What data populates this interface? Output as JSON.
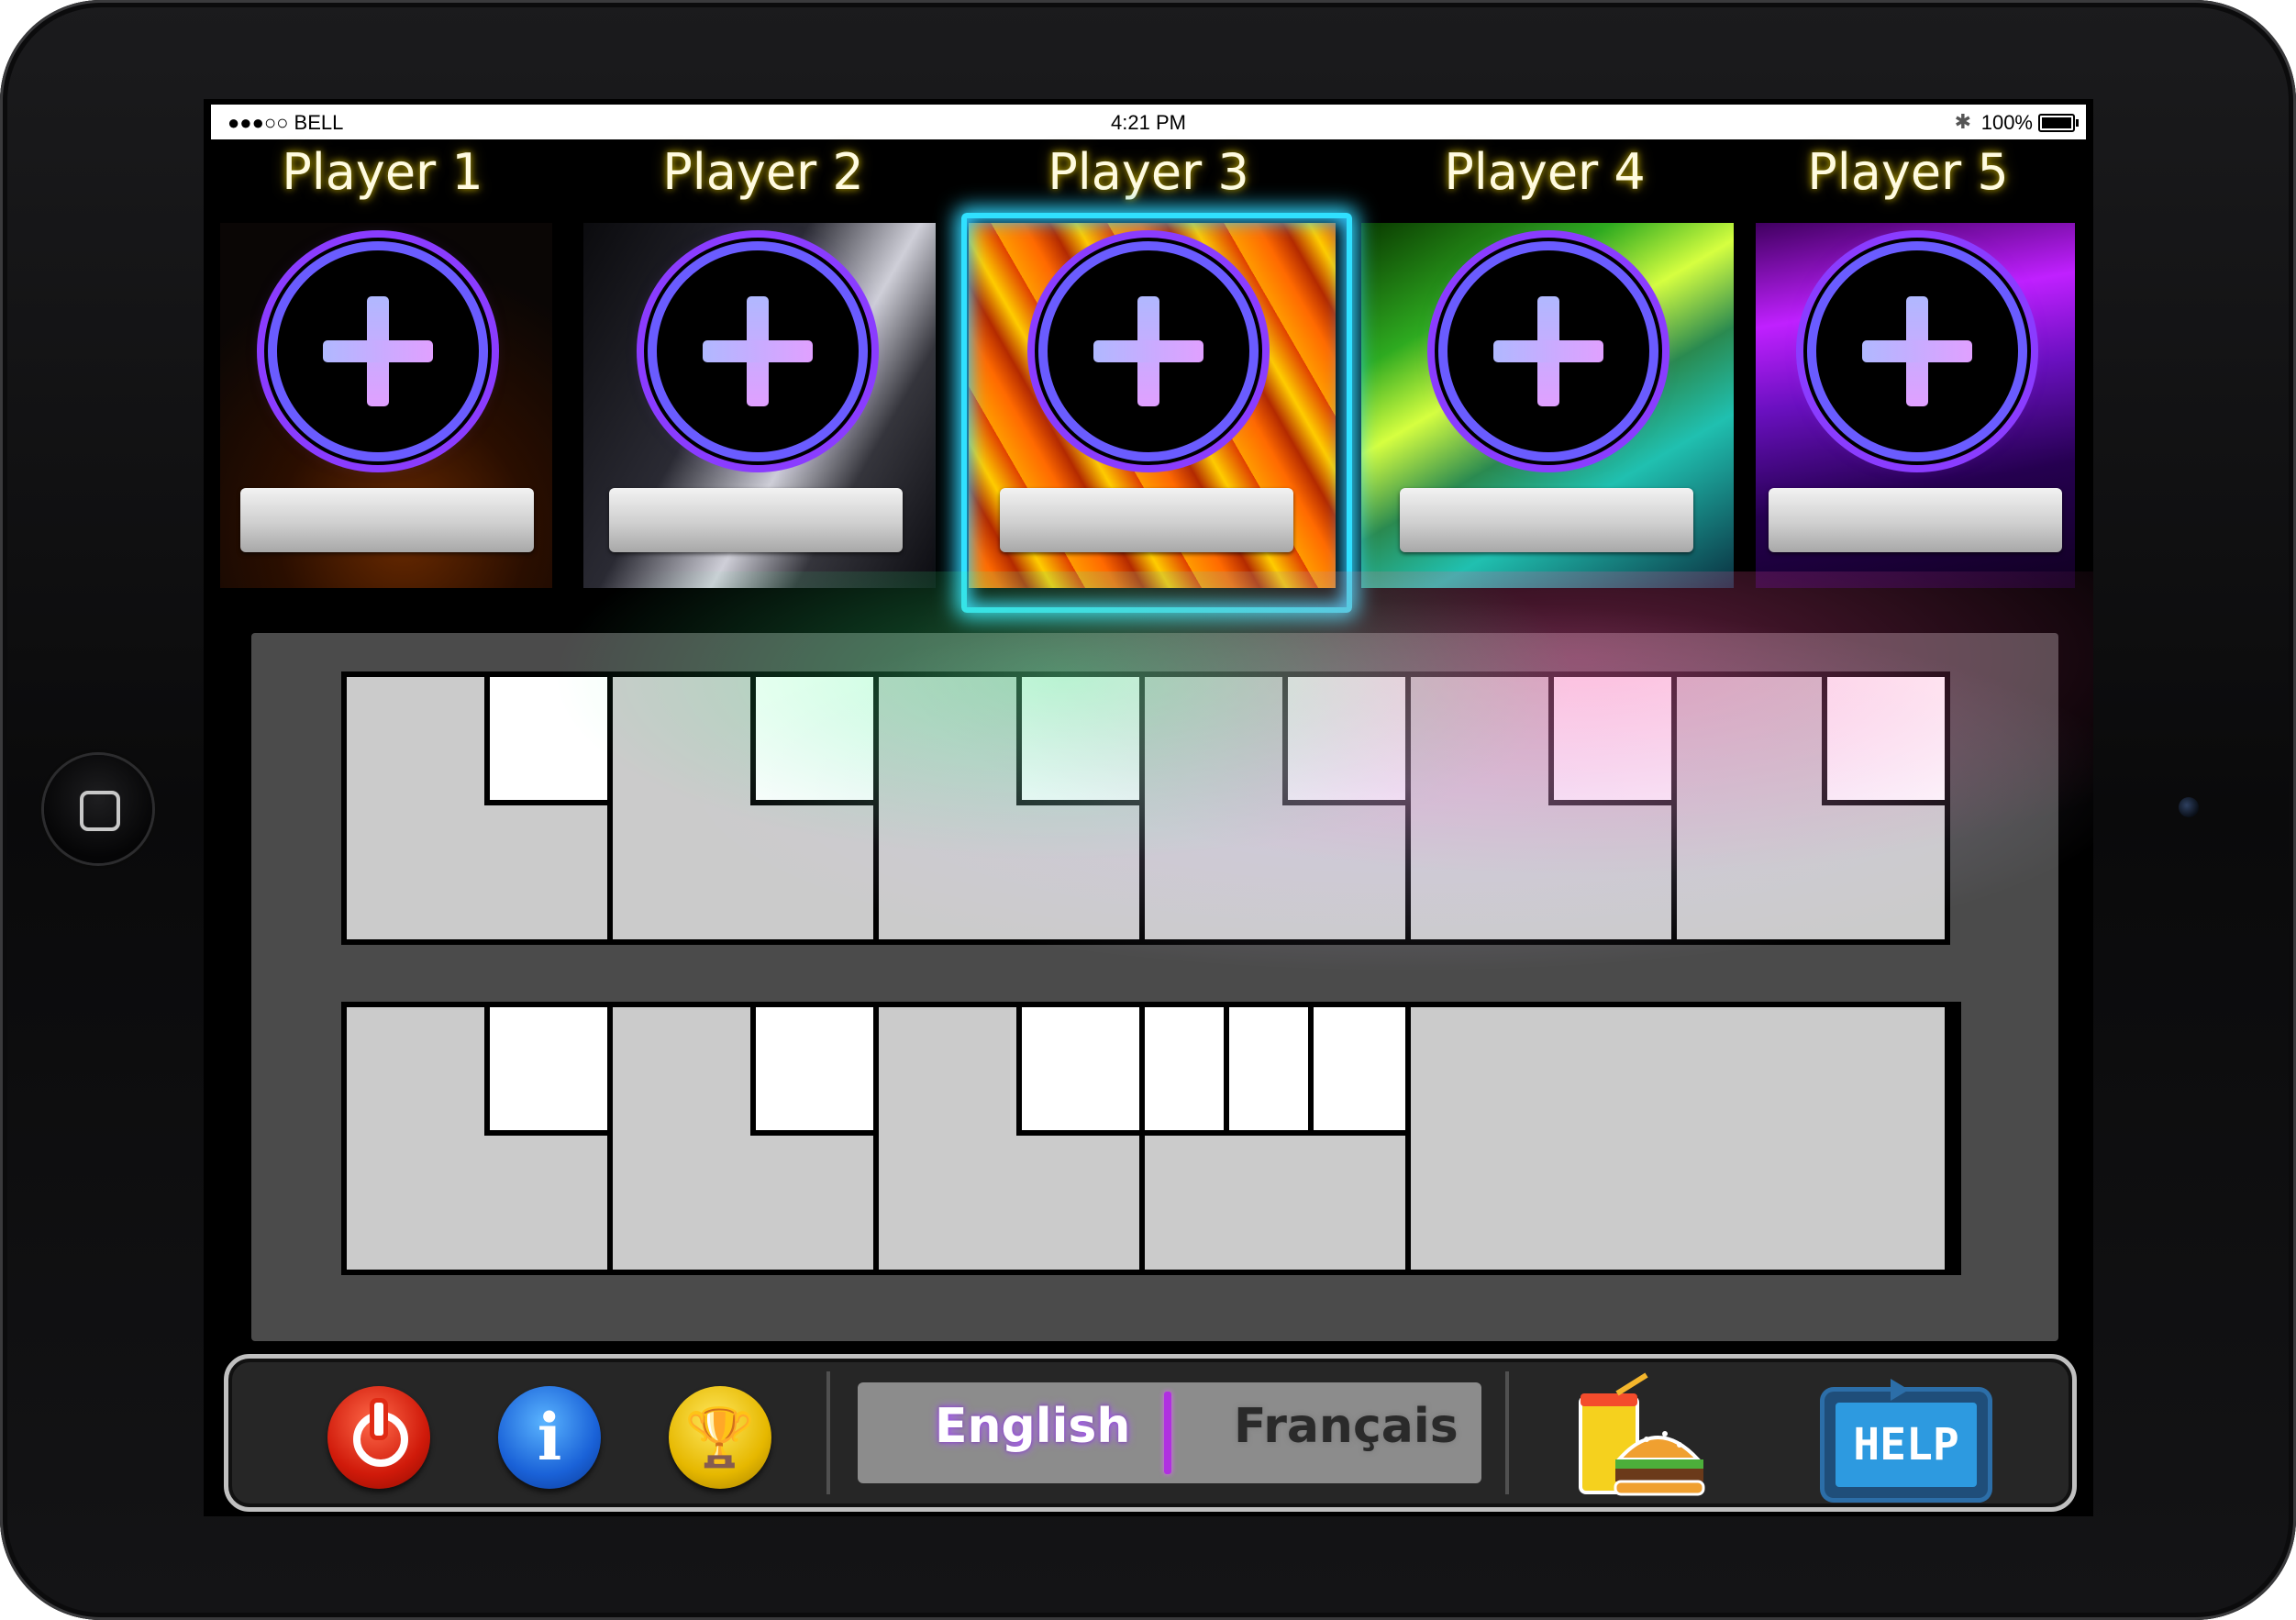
{
  "status_bar": {
    "carrier": "●●●○○ BELL",
    "time": "4:21 PM",
    "battery": "100%"
  },
  "players": [
    {
      "label": "Player 1",
      "name": ""
    },
    {
      "label": "Player 2",
      "name": ""
    },
    {
      "label": "Player 3",
      "name": "",
      "selected": true
    },
    {
      "label": "Player 4",
      "name": ""
    },
    {
      "label": "Player 5",
      "name": ""
    }
  ],
  "toolbar": {
    "language_english": "English",
    "language_french": "Français",
    "help_label": "HELP",
    "selected_language": "English"
  },
  "colors": {
    "selection_glow": "#30e0ff",
    "add_ring": "#8a3cff",
    "score_panel": "#4b4b4b"
  }
}
